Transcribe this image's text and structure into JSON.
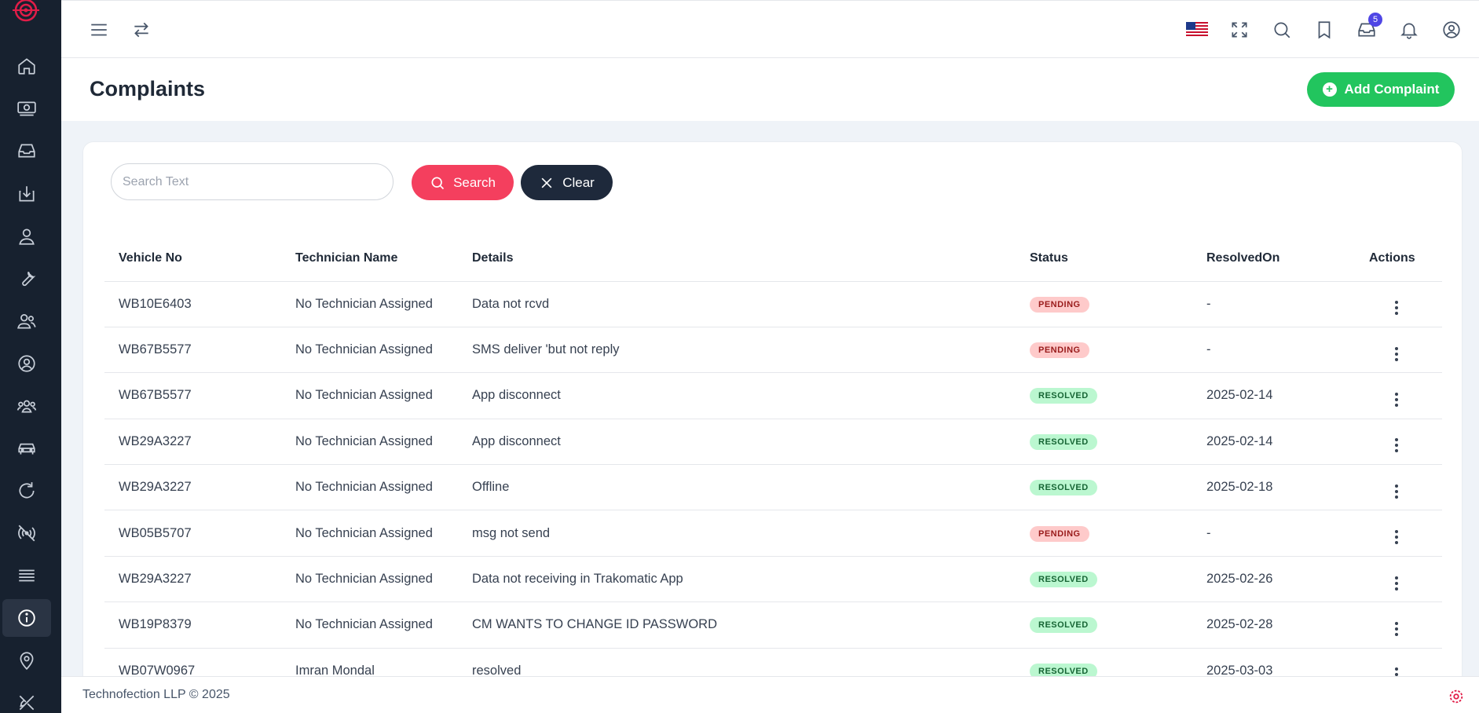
{
  "page": {
    "title": "Complaints",
    "add_button_label": "Add Complaint"
  },
  "topbar": {
    "inbox_count": "5"
  },
  "search": {
    "placeholder": "Search Text",
    "search_label": "Search",
    "clear_label": "Clear"
  },
  "table": {
    "headers": [
      "Vehicle No",
      "Technician Name",
      "Details",
      "Status",
      "ResolvedOn",
      "Actions"
    ],
    "rows": [
      {
        "vehicle": "WB10E6403",
        "technician": "No Technician Assigned",
        "details": "Data not rcvd",
        "status": "PENDING",
        "resolved_on": "-"
      },
      {
        "vehicle": "WB67B5577",
        "technician": "No Technician Assigned",
        "details": "SMS deliver 'but not reply",
        "status": "PENDING",
        "resolved_on": "-"
      },
      {
        "vehicle": "WB67B5577",
        "technician": "No Technician Assigned",
        "details": "App disconnect",
        "status": "RESOLVED",
        "resolved_on": "2025-02-14"
      },
      {
        "vehicle": "WB29A3227",
        "technician": "No Technician Assigned",
        "details": "App disconnect",
        "status": "RESOLVED",
        "resolved_on": "2025-02-14"
      },
      {
        "vehicle": "WB29A3227",
        "technician": "No Technician Assigned",
        "details": "Offline",
        "status": "RESOLVED",
        "resolved_on": "2025-02-18"
      },
      {
        "vehicle": "WB05B5707",
        "technician": "No Technician Assigned",
        "details": "msg not send",
        "status": "PENDING",
        "resolved_on": "-"
      },
      {
        "vehicle": "WB29A3227",
        "technician": "No Technician Assigned",
        "details": "Data not receiving in Trakomatic App",
        "status": "RESOLVED",
        "resolved_on": "2025-02-26"
      },
      {
        "vehicle": "WB19P8379",
        "technician": "No Technician Assigned",
        "details": "CM WANTS TO CHANGE ID PASSWORD",
        "status": "RESOLVED",
        "resolved_on": "2025-02-28"
      },
      {
        "vehicle": "WB07W0967",
        "technician": "Imran Mondal",
        "details": "resolved",
        "status": "RESOLVED",
        "resolved_on": "2025-03-03"
      }
    ]
  },
  "footer": {
    "copyright": "Technofection LLP © 2025"
  },
  "sidebar": {
    "items": [
      "home-icon",
      "money-icon",
      "inbox-icon",
      "download-icon",
      "user-icon",
      "wrench-icon",
      "users-icon",
      "user-circle-icon",
      "group-icon",
      "car-icon",
      "refresh-icon",
      "signal-icon",
      "list-icon",
      "info-icon",
      "location-icon",
      "tools-icon"
    ],
    "active_item": "info-icon"
  },
  "colors": {
    "sidebar_bg": "#17212f",
    "accent_green": "#22c55e",
    "search_red": "#f43f5e",
    "clear_dark": "#1e293b",
    "badge": "#4f46e5"
  }
}
